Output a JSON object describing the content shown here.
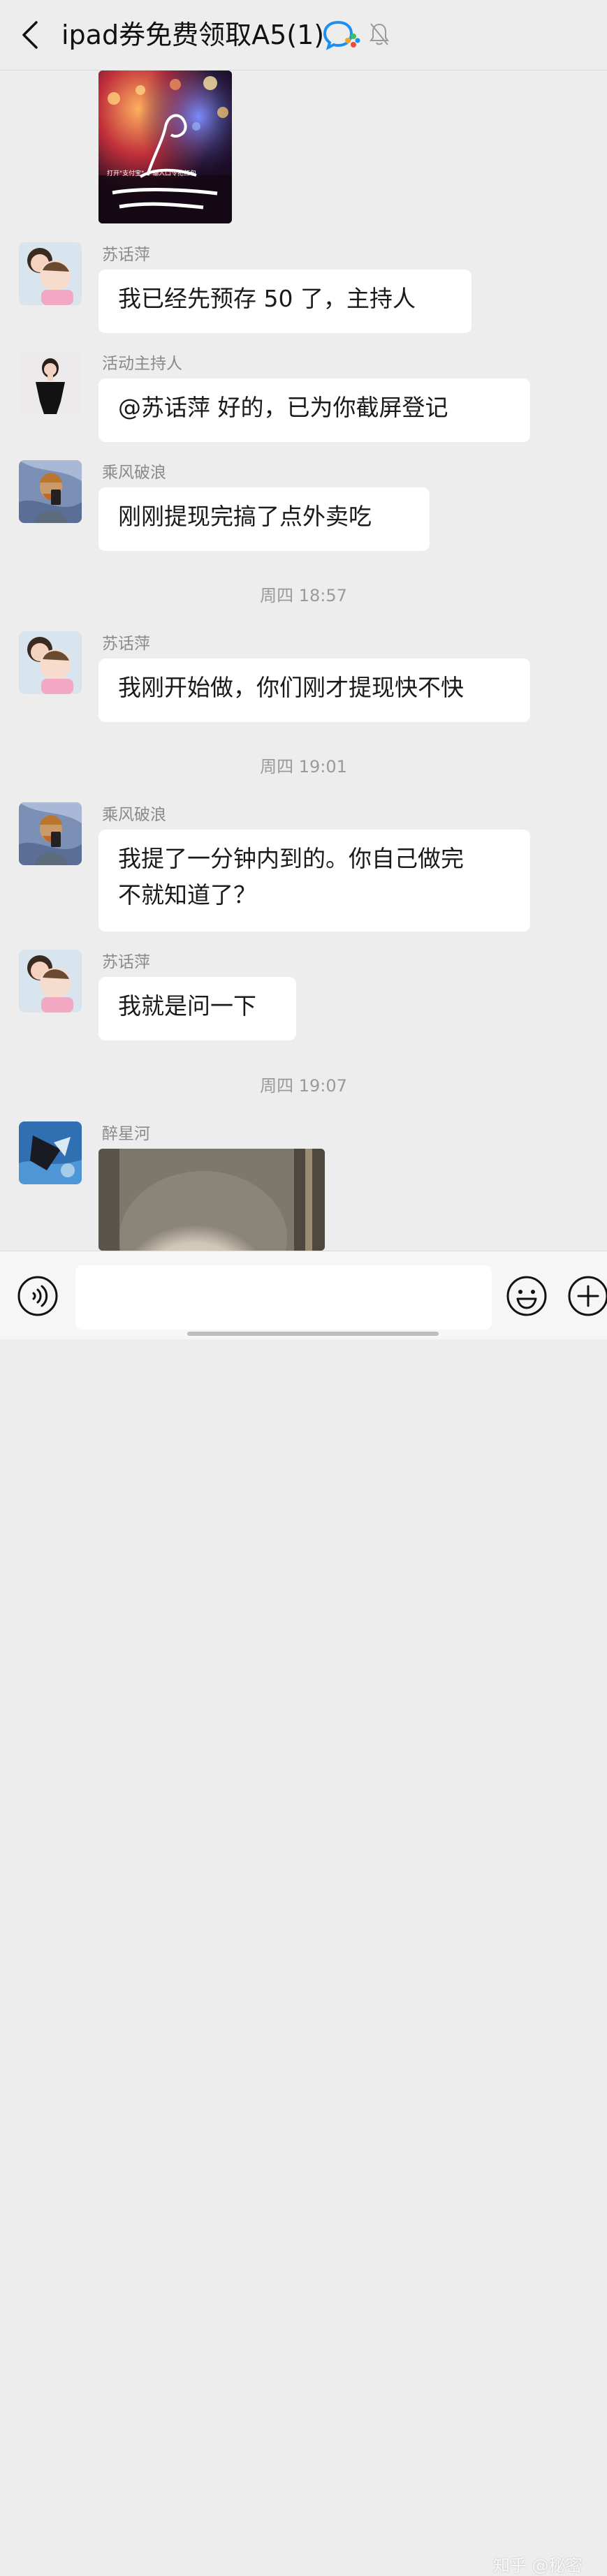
{
  "header": {
    "title": "ipad券免费领取A5(1)",
    "back_icon": "chevron-left-icon",
    "wecom_icon": "wecom-logo-icon",
    "mute_icon": "bell-muted-icon"
  },
  "messages": [
    {
      "type": "image",
      "sender": "",
      "caption_text": "打开\"支付宝\"… 输入口令抢红包"
    },
    {
      "type": "text",
      "sender": "苏话萍",
      "text": "我已经先预存 50 了，主持人"
    },
    {
      "type": "text",
      "sender": "活动主持人",
      "text": "@苏话萍  好的，已为你截屏登记"
    },
    {
      "type": "text",
      "sender": "乘风破浪",
      "text": "刚刚提现完搞了点外卖吃"
    },
    {
      "type": "time",
      "text": "周四 18:57"
    },
    {
      "type": "text",
      "sender": "苏话萍",
      "text": "我刚开始做，你们刚才提现快不快"
    },
    {
      "type": "time",
      "text": "周四 19:01"
    },
    {
      "type": "text",
      "sender": "乘风破浪",
      "lines": [
        "我提了一分钟内到的。你自己做完",
        "不就知道了？"
      ]
    },
    {
      "type": "text",
      "sender": "苏话萍",
      "text": "我就是问一下"
    },
    {
      "type": "time",
      "text": "周四 19:07"
    },
    {
      "type": "image",
      "sender": "醉星河"
    }
  ],
  "input_bar": {
    "voice_icon": "voice-icon",
    "emoji_icon": "emoji-icon",
    "plus_icon": "plus-icon",
    "placeholder": ""
  },
  "watermark": "知乎 @秘密",
  "colors": {
    "background": "#ededed",
    "bubble": "#ffffff",
    "text": "#1a1a1a",
    "meta": "#8a8a8a"
  }
}
